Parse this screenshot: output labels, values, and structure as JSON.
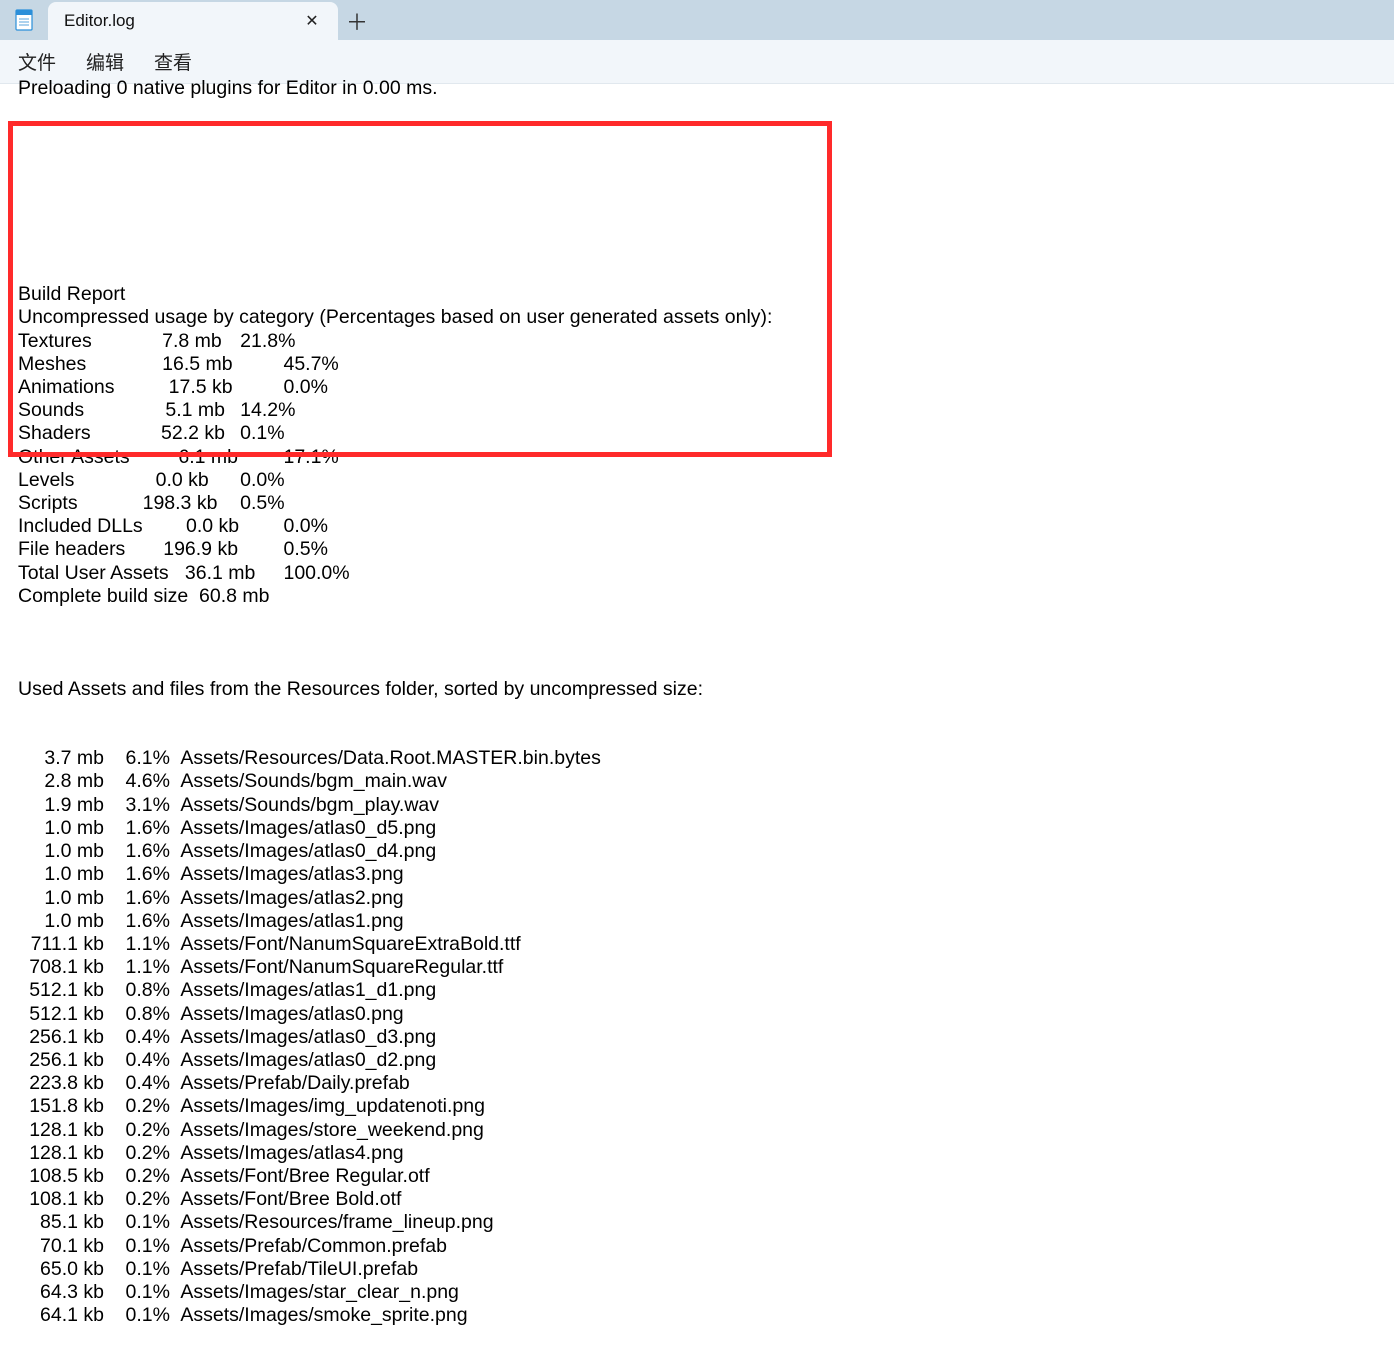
{
  "tab": {
    "title": "Editor.log"
  },
  "menu": {
    "file": "文件",
    "edit": "编辑",
    "view": "查看"
  },
  "cutoff": "Preloading 0 native plugins for Editor in 0.00 ms.",
  "build_report": {
    "title": "Build Report",
    "subtitle": "Uncompressed usage by category (Percentages based on user generated assets only):",
    "rows": [
      {
        "cat": "Textures",
        "size": "7.8 mb",
        "pct": "21.8%"
      },
      {
        "cat": "Meshes",
        "size": "16.5 mb",
        "pct": "45.7%"
      },
      {
        "cat": "Animations",
        "size": "17.5 kb",
        "pct": "0.0%"
      },
      {
        "cat": "Sounds",
        "size": "5.1 mb",
        "pct": "14.2%"
      },
      {
        "cat": "Shaders",
        "size": "52.2 kb",
        "pct": "0.1%"
      },
      {
        "cat": "Other Assets",
        "size": "6.1 mb",
        "pct": "17.1%"
      },
      {
        "cat": "Levels",
        "size": "0.0 kb",
        "pct": "0.0%"
      },
      {
        "cat": "Scripts",
        "size": "198.3 kb",
        "pct": "0.5%"
      },
      {
        "cat": "Included DLLs",
        "size": "0.0 kb",
        "pct": "0.0%"
      },
      {
        "cat": "File headers",
        "size": "196.9 kb",
        "pct": "0.5%"
      },
      {
        "cat": "Total User Assets",
        "size": "36.1 mb",
        "pct": "100.0%"
      }
    ],
    "complete": {
      "label": "Complete build size",
      "size": "60.8 mb"
    }
  },
  "assets_header": "Used Assets and files from the Resources folder, sorted by uncompressed size:",
  "assets": [
    {
      "size": "3.7 mb",
      "pct": "6.1%",
      "path": "Assets/Resources/Data.Root.MASTER.bin.bytes"
    },
    {
      "size": "2.8 mb",
      "pct": "4.6%",
      "path": "Assets/Sounds/bgm_main.wav"
    },
    {
      "size": "1.9 mb",
      "pct": "3.1%",
      "path": "Assets/Sounds/bgm_play.wav"
    },
    {
      "size": "1.0 mb",
      "pct": "1.6%",
      "path": "Assets/Images/atlas0_d5.png"
    },
    {
      "size": "1.0 mb",
      "pct": "1.6%",
      "path": "Assets/Images/atlas0_d4.png"
    },
    {
      "size": "1.0 mb",
      "pct": "1.6%",
      "path": "Assets/Images/atlas3.png"
    },
    {
      "size": "1.0 mb",
      "pct": "1.6%",
      "path": "Assets/Images/atlas2.png"
    },
    {
      "size": "1.0 mb",
      "pct": "1.6%",
      "path": "Assets/Images/atlas1.png"
    },
    {
      "size": "711.1 kb",
      "pct": "1.1%",
      "path": "Assets/Font/NanumSquareExtraBold.ttf"
    },
    {
      "size": "708.1 kb",
      "pct": "1.1%",
      "path": "Assets/Font/NanumSquareRegular.ttf"
    },
    {
      "size": "512.1 kb",
      "pct": "0.8%",
      "path": "Assets/Images/atlas1_d1.png"
    },
    {
      "size": "512.1 kb",
      "pct": "0.8%",
      "path": "Assets/Images/atlas0.png"
    },
    {
      "size": "256.1 kb",
      "pct": "0.4%",
      "path": "Assets/Images/atlas0_d3.png"
    },
    {
      "size": "256.1 kb",
      "pct": "0.4%",
      "path": "Assets/Images/atlas0_d2.png"
    },
    {
      "size": "223.8 kb",
      "pct": "0.4%",
      "path": "Assets/Prefab/Daily.prefab"
    },
    {
      "size": "151.8 kb",
      "pct": "0.2%",
      "path": "Assets/Images/img_updatenoti.png"
    },
    {
      "size": "128.1 kb",
      "pct": "0.2%",
      "path": "Assets/Images/store_weekend.png"
    },
    {
      "size": "128.1 kb",
      "pct": "0.2%",
      "path": "Assets/Images/atlas4.png"
    },
    {
      "size": "108.5 kb",
      "pct": "0.2%",
      "path": "Assets/Font/Bree Regular.otf"
    },
    {
      "size": "108.1 kb",
      "pct": "0.2%",
      "path": "Assets/Font/Bree Bold.otf"
    },
    {
      "size": "85.1 kb",
      "pct": "0.1%",
      "path": "Assets/Resources/frame_lineup.png"
    },
    {
      "size": "70.1 kb",
      "pct": "0.1%",
      "path": "Assets/Prefab/Common.prefab"
    },
    {
      "size": "65.0 kb",
      "pct": "0.1%",
      "path": "Assets/Prefab/TileUI.prefab"
    },
    {
      "size": "64.3 kb",
      "pct": "0.1%",
      "path": "Assets/Images/star_clear_n.png"
    },
    {
      "size": "64.1 kb",
      "pct": "0.1%",
      "path": "Assets/Images/smoke_sprite.png"
    }
  ]
}
